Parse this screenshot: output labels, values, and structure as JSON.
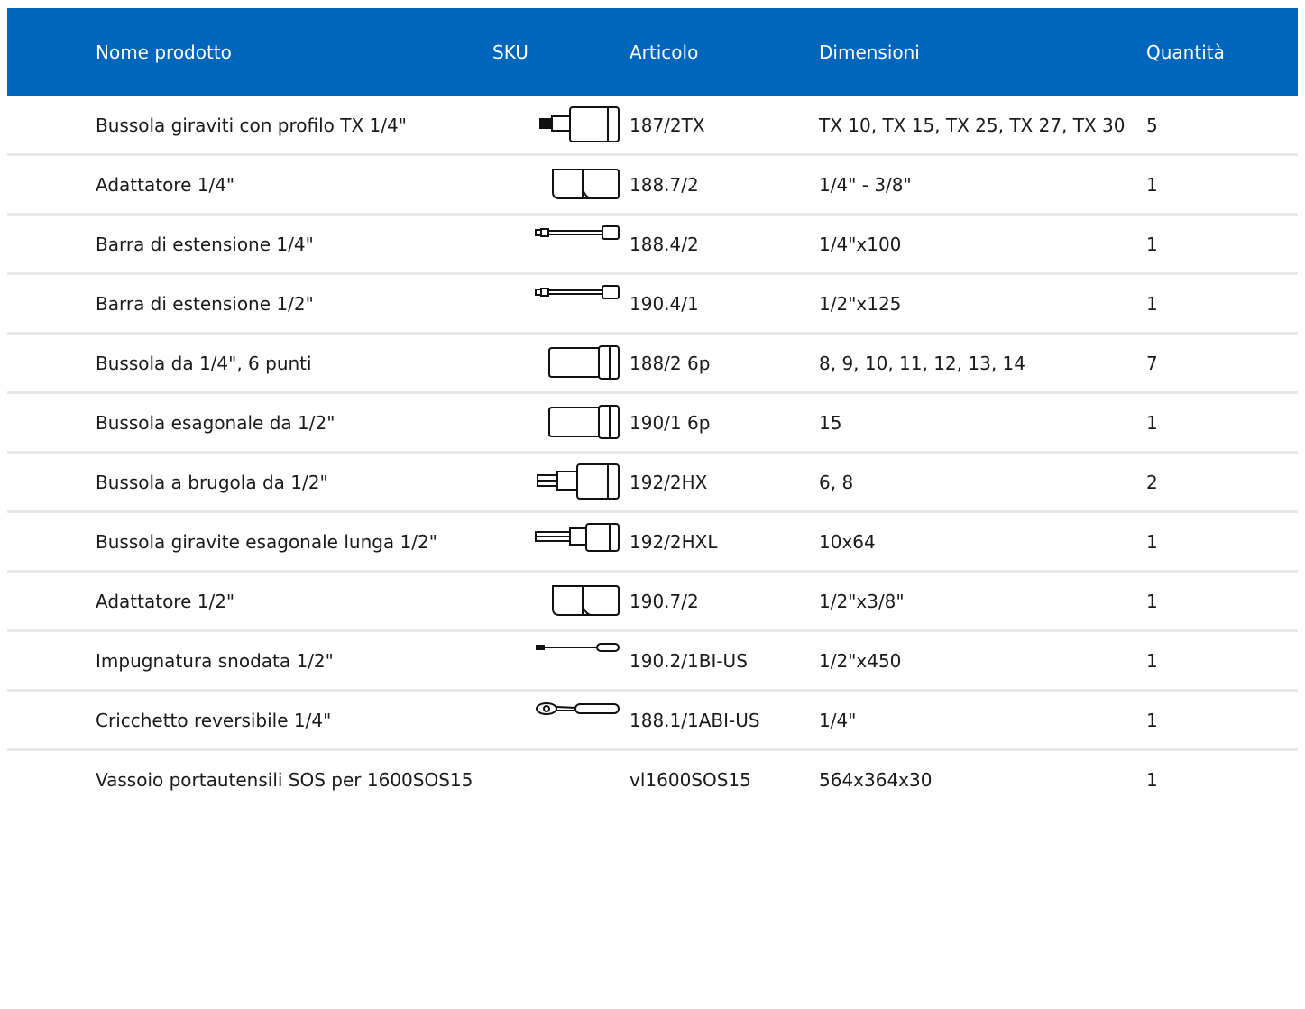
{
  "header": {
    "name": "Nome prodotto",
    "sku": "SKU",
    "article": "Articolo",
    "dimensions": "Dimensioni",
    "quantity": "Quantità"
  },
  "rows": [
    {
      "name": "Bussola giraviti con profilo TX 1/4\"",
      "icon": "tx-bit-socket-icon",
      "article": "187/2TX",
      "dimensions": "TX 10, TX 15, TX 25, TX 27, TX 30",
      "quantity": "5"
    },
    {
      "name": "Adattatore 1/4\"",
      "icon": "adapter-icon",
      "article": "188.7/2",
      "dimensions": "1/4\" - 3/8\"",
      "quantity": "1"
    },
    {
      "name": "Barra di estensione 1/4\"",
      "icon": "extension-bar-icon",
      "article": "188.4/2",
      "dimensions": "1/4\"x100",
      "quantity": "1"
    },
    {
      "name": "Barra di estensione 1/2\"",
      "icon": "extension-bar-icon",
      "article": "190.4/1",
      "dimensions": "1/2\"x125",
      "quantity": "1"
    },
    {
      "name": "Bussola da 1/4\", 6 punti",
      "icon": "socket-icon",
      "article": "188/2 6p",
      "dimensions": "8, 9, 10, 11, 12, 13, 14",
      "quantity": "7"
    },
    {
      "name": "Bussola esagonale da 1/2\"",
      "icon": "socket-icon",
      "article": "190/1 6p",
      "dimensions": "15",
      "quantity": "1"
    },
    {
      "name": "Bussola a brugola da 1/2\"",
      "icon": "hex-bit-socket-icon",
      "article": "192/2HX",
      "dimensions": "6, 8",
      "quantity": "2"
    },
    {
      "name": "Bussola giravite esagonale lunga 1/2\"",
      "icon": "long-hex-bit-socket-icon",
      "article": "192/2HXL",
      "dimensions": "10x64",
      "quantity": "1"
    },
    {
      "name": "Adattatore 1/2\"",
      "icon": "adapter-icon",
      "article": "190.7/2",
      "dimensions": "1/2\"x3/8\"",
      "quantity": "1"
    },
    {
      "name": "Impugnatura snodata 1/2\"",
      "icon": "breaker-bar-icon",
      "article": "190.2/1BI-US",
      "dimensions": "1/2\"x450",
      "quantity": "1"
    },
    {
      "name": "Cricchetto reversibile 1/4\"",
      "icon": "ratchet-icon",
      "article": "188.1/1ABI-US",
      "dimensions": "1/4\"",
      "quantity": "1"
    },
    {
      "name": "Vassoio portautensili SOS per 1600SOS15",
      "icon": "",
      "article": "vl1600SOS15",
      "dimensions": "564x364x30",
      "quantity": "1"
    }
  ]
}
